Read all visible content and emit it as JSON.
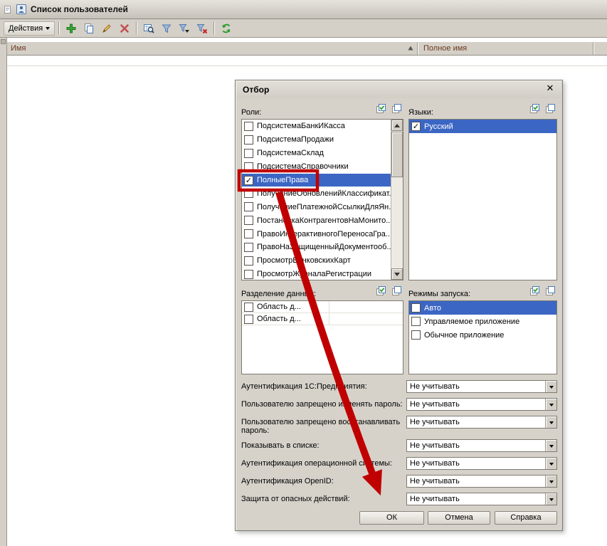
{
  "colors": {
    "selection_blue": "#3b66c4",
    "annotation_red": "#c00000",
    "header_text": "#6e3a20",
    "window_gray": "#d4d0c8"
  },
  "window": {
    "title": "Список пользователей",
    "toolbar": {
      "actions_label": "Действия",
      "buttons": [
        "add",
        "copy",
        "edit",
        "delete",
        "find",
        "filter",
        "filter-menu",
        "clear-filter",
        "refresh"
      ]
    },
    "columns": [
      {
        "label": "Имя"
      },
      {
        "label": "Полное имя"
      }
    ]
  },
  "dialog": {
    "title": "Отбор",
    "close_glyph": "✕",
    "roles": {
      "label": "Роли:",
      "items": [
        {
          "label": "ПодсистемаБанкИКасса",
          "checked": false,
          "selected": false
        },
        {
          "label": "ПодсистемаПродажи",
          "checked": false,
          "selected": false
        },
        {
          "label": "ПодсистемаСклад",
          "checked": false,
          "selected": false
        },
        {
          "label": "ПодсистемаСправочники",
          "checked": false,
          "selected": false
        },
        {
          "label": "ПолныеПрава",
          "checked": true,
          "selected": true,
          "annotated": true
        },
        {
          "label": "ПолучениеОбновленийКлассификат...",
          "checked": false,
          "selected": false
        },
        {
          "label": "ПолучениеПлатежнойСсылкиДляЯн...",
          "checked": false,
          "selected": false
        },
        {
          "label": "ПостановкаКонтрагентовНаМонито...",
          "checked": false,
          "selected": false
        },
        {
          "label": "ПравоИнтерактивногоПереносаГра...",
          "checked": false,
          "selected": false
        },
        {
          "label": "ПравоНаЗащищенныйДокументооб...",
          "checked": false,
          "selected": false
        },
        {
          "label": "ПросмотрБанковскихКарт",
          "checked": false,
          "selected": false
        },
        {
          "label": "ПросмотрЖурналаРегистрации",
          "checked": false,
          "selected": false
        }
      ]
    },
    "languages": {
      "label": "Языки:",
      "items": [
        {
          "label": "Русский",
          "checked": true,
          "selected": true
        }
      ]
    },
    "data_separation": {
      "label": "Разделение данных:",
      "items": [
        {
          "label": "Область д...",
          "checked": false,
          "selected": false
        },
        {
          "label": "Область д...",
          "checked": false,
          "selected": false
        }
      ]
    },
    "launch_modes": {
      "label": "Режимы запуска:",
      "items": [
        {
          "label": "Авто",
          "checked": false,
          "selected": true
        },
        {
          "label": "Управляемое приложение",
          "checked": false,
          "selected": false
        },
        {
          "label": "Обычное приложение",
          "checked": false,
          "selected": false
        }
      ]
    },
    "fields": [
      {
        "label": "Аутентификация 1С:Предприятия:",
        "value": "Не учитывать",
        "two_line": false
      },
      {
        "label": "Пользователю запрещено изменять пароль:",
        "value": "Не учитывать",
        "two_line": false
      },
      {
        "label": "Пользователю запрещено восстанавливать пароль:",
        "value": "Не учитывать",
        "two_line": true
      },
      {
        "label": "Показывать в списке:",
        "value": "Не учитывать",
        "two_line": false
      },
      {
        "label": "Аутентификация операционной системы:",
        "value": "Не учитывать",
        "two_line": false
      },
      {
        "label": "Аутентификация OpenID:",
        "value": "Не учитывать",
        "two_line": false
      },
      {
        "label": "Защита от опасных действий:",
        "value": "Не учитывать",
        "two_line": false
      }
    ],
    "buttons": [
      {
        "label": "ОК"
      },
      {
        "label": "Отмена"
      },
      {
        "label": "Справка"
      }
    ]
  }
}
